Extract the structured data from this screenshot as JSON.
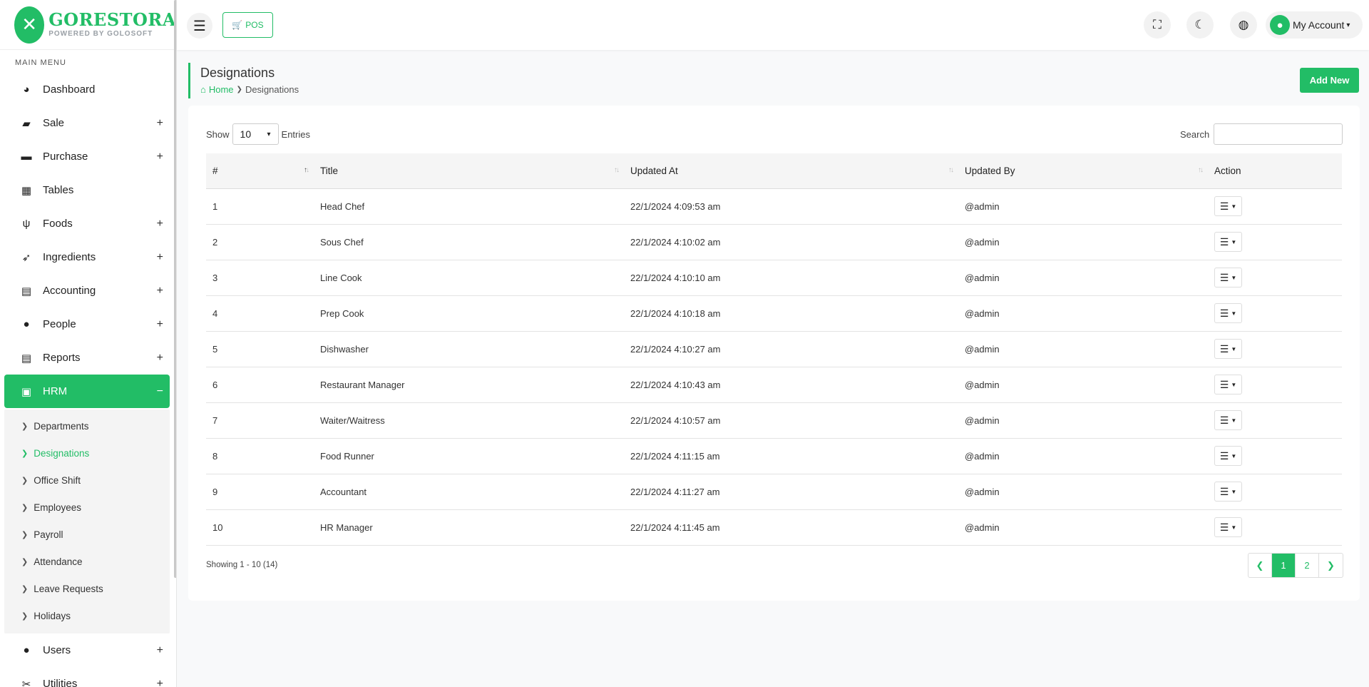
{
  "brand": {
    "title": "GORESTORA",
    "subtitle": "POWERED BY GOLOSOFT",
    "color": "#22bd66"
  },
  "sidebar": {
    "heading": "MAIN MENU",
    "items": [
      {
        "label": "Dashboard",
        "icon": "palette-icon"
      },
      {
        "label": "Sale",
        "icon": "briefcase-icon",
        "expand": "+"
      },
      {
        "label": "Purchase",
        "icon": "credit-card-icon",
        "expand": "+"
      },
      {
        "label": "Tables",
        "icon": "table-icon"
      },
      {
        "label": "Foods",
        "icon": "utensils-icon",
        "expand": "+"
      },
      {
        "label": "Ingredients",
        "icon": "carrot-icon",
        "expand": "+"
      },
      {
        "label": "Accounting",
        "icon": "calculator-icon",
        "expand": "+"
      },
      {
        "label": "People",
        "icon": "users-icon",
        "expand": "+"
      },
      {
        "label": "Reports",
        "icon": "file-icon",
        "expand": "+"
      },
      {
        "label": "HRM",
        "icon": "toolbox-icon",
        "expand": "−"
      },
      {
        "label": "Users",
        "icon": "user-icon",
        "expand": "+"
      },
      {
        "label": "Utilities",
        "icon": "tools-icon",
        "expand": "+"
      }
    ],
    "hrm_sub": [
      "Departments",
      "Designations",
      "Office Shift",
      "Employees",
      "Payroll",
      "Attendance",
      "Leave Requests",
      "Holidays"
    ]
  },
  "topbar": {
    "pos_label": "POS",
    "account_label": "My Account"
  },
  "page": {
    "title": "Designations",
    "breadcrumb_home": "Home",
    "breadcrumb_current": "Designations",
    "add_label": "Add New"
  },
  "table_controls": {
    "show_label": "Show",
    "entries_value": "10",
    "entries_label": "Entries",
    "search_label": "Search"
  },
  "table": {
    "headers": [
      "#",
      "Title",
      "Updated At",
      "Updated By",
      "Action"
    ],
    "rows": [
      [
        "1",
        "Head Chef",
        "22/1/2024 4:09:53 am",
        "@admin"
      ],
      [
        "2",
        "Sous Chef",
        "22/1/2024 4:10:02 am",
        "@admin"
      ],
      [
        "3",
        "Line Cook",
        "22/1/2024 4:10:10 am",
        "@admin"
      ],
      [
        "4",
        "Prep Cook",
        "22/1/2024 4:10:18 am",
        "@admin"
      ],
      [
        "5",
        "Dishwasher",
        "22/1/2024 4:10:27 am",
        "@admin"
      ],
      [
        "6",
        "Restaurant Manager",
        "22/1/2024 4:10:43 am",
        "@admin"
      ],
      [
        "7",
        "Waiter/Waitress",
        "22/1/2024 4:10:57 am",
        "@admin"
      ],
      [
        "8",
        "Food Runner",
        "22/1/2024 4:11:15 am",
        "@admin"
      ],
      [
        "9",
        "Accountant",
        "22/1/2024 4:11:27 am",
        "@admin"
      ],
      [
        "10",
        "HR Manager",
        "22/1/2024 4:11:45 am",
        "@admin"
      ]
    ]
  },
  "footer": {
    "showing": "Showing 1 - 10 (14)",
    "pages": [
      "1",
      "2"
    ],
    "current_page": "1"
  }
}
